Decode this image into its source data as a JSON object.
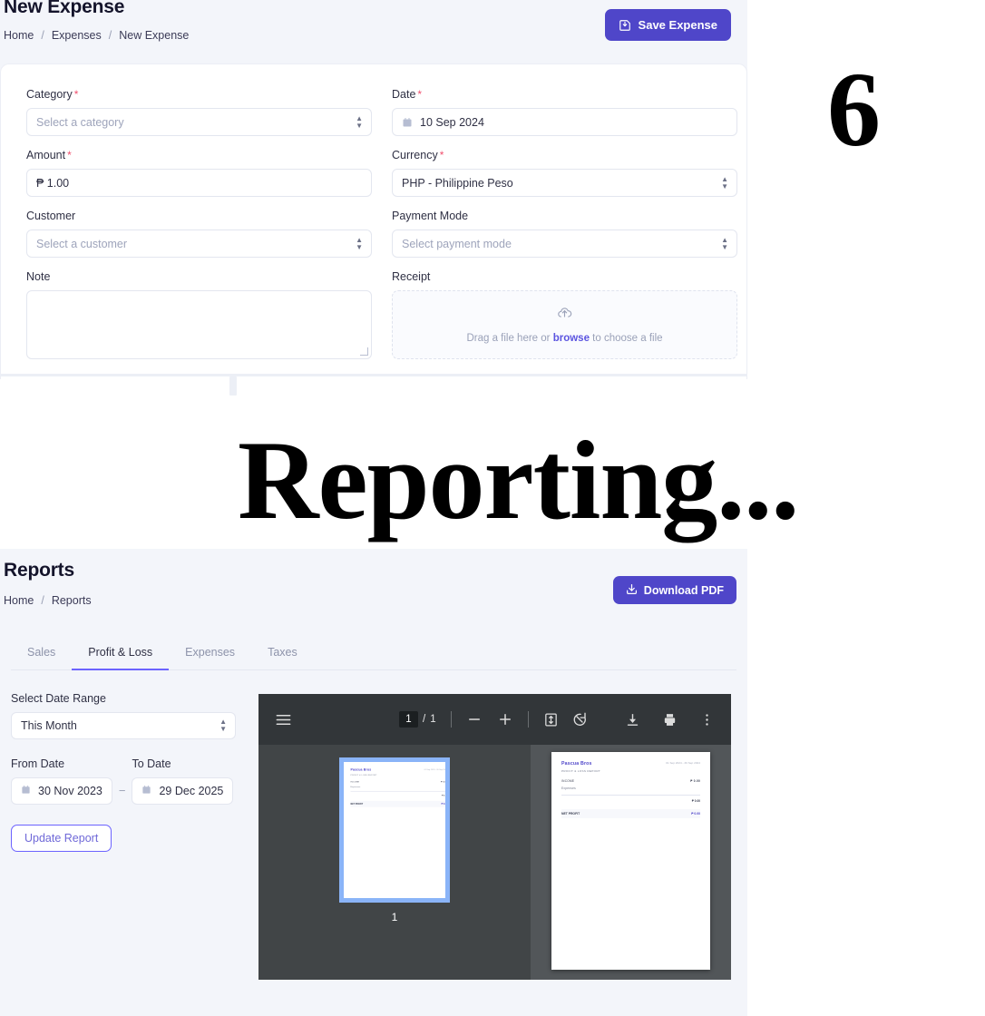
{
  "expense": {
    "title": "New Expense",
    "breadcrumb": [
      "Home",
      "Expenses",
      "New Expense"
    ],
    "save_button": "Save Expense",
    "save_icon": "save-tray-icon",
    "fields": {
      "category": {
        "label": "Category",
        "required": "*",
        "placeholder": "Select a category"
      },
      "date": {
        "label": "Date",
        "required": "*",
        "value": "10 Sep 2024",
        "icon": "calendar-icon"
      },
      "amount": {
        "label": "Amount",
        "required": "*",
        "value": "₱ 1.00"
      },
      "currency": {
        "label": "Currency",
        "required": "*",
        "value": "PHP - Philippine Peso"
      },
      "customer": {
        "label": "Customer",
        "placeholder": "Select a customer"
      },
      "payment_mode": {
        "label": "Payment Mode",
        "placeholder": "Select payment mode"
      },
      "note": {
        "label": "Note",
        "value": ""
      },
      "receipt": {
        "label": "Receipt",
        "icon": "cloud-upload-icon",
        "drop_text_before": "Drag a file here or ",
        "drop_link": "browse",
        "drop_text_after": " to choose a file"
      }
    }
  },
  "slide": {
    "number": "6",
    "heading": "Reporting..."
  },
  "reports": {
    "title": "Reports",
    "breadcrumb": [
      "Home",
      "Reports"
    ],
    "download_button": "Download PDF",
    "download_icon": "download-icon",
    "tabs": [
      {
        "label": "Sales",
        "active": false
      },
      {
        "label": "Profit & Loss",
        "active": true
      },
      {
        "label": "Expenses",
        "active": false
      },
      {
        "label": "Taxes",
        "active": false
      }
    ],
    "filters": {
      "range_label": "Select Date Range",
      "range_value": "This Month",
      "from_label": "From Date",
      "from_value": "30 Nov 2023",
      "to_label": "To Date",
      "to_value": "29 Dec 2025",
      "separator": "−",
      "update_button": "Update Report"
    }
  },
  "pdf": {
    "toolbar": {
      "menu_icon": "hamburger-menu-icon",
      "current_page": "1",
      "page_separator": "/",
      "total_pages": "1",
      "zoom_out_icon": "minus-icon",
      "zoom_in_icon": "plus-icon",
      "fit_page_icon": "fit-page-icon",
      "rotate_icon": "rotate-icon",
      "download_icon": "download-icon",
      "print_icon": "print-icon",
      "more_icon": "more-vertical-icon"
    },
    "thumbnail_label": "1",
    "document": {
      "company": "Pascua Bros",
      "subtitle": "PROFIT & LOSS REPORT",
      "range": "01 Sep 2024 - 30 Sep 2024",
      "rows": [
        {
          "label": "INCOME",
          "value": "₱ 0.00"
        },
        {
          "label": "Expenses",
          "value": ""
        }
      ],
      "subtotal": "₱ 0.00",
      "net_label": "NET PROFIT",
      "net_value": "₱ 0.00"
    }
  },
  "colors": {
    "primary": "#4f46c9",
    "accent": "#6c63ff",
    "panel_bg": "#f3f5fa",
    "pdf_bg": "#525659",
    "pdf_toolbar": "#323639",
    "thumb_select": "#8ab4f8"
  }
}
